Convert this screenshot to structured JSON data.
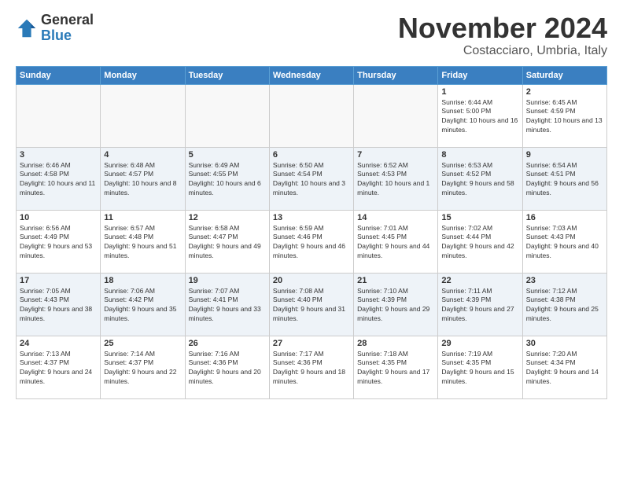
{
  "logo": {
    "general": "General",
    "blue": "Blue"
  },
  "title": "November 2024",
  "subtitle": "Costacciaro, Umbria, Italy",
  "days_of_week": [
    "Sunday",
    "Monday",
    "Tuesday",
    "Wednesday",
    "Thursday",
    "Friday",
    "Saturday"
  ],
  "weeks": [
    [
      {
        "day": "",
        "info": ""
      },
      {
        "day": "",
        "info": ""
      },
      {
        "day": "",
        "info": ""
      },
      {
        "day": "",
        "info": ""
      },
      {
        "day": "",
        "info": ""
      },
      {
        "day": "1",
        "info": "Sunrise: 6:44 AM\nSunset: 5:00 PM\nDaylight: 10 hours and 16 minutes."
      },
      {
        "day": "2",
        "info": "Sunrise: 6:45 AM\nSunset: 4:59 PM\nDaylight: 10 hours and 13 minutes."
      }
    ],
    [
      {
        "day": "3",
        "info": "Sunrise: 6:46 AM\nSunset: 4:58 PM\nDaylight: 10 hours and 11 minutes."
      },
      {
        "day": "4",
        "info": "Sunrise: 6:48 AM\nSunset: 4:57 PM\nDaylight: 10 hours and 8 minutes."
      },
      {
        "day": "5",
        "info": "Sunrise: 6:49 AM\nSunset: 4:55 PM\nDaylight: 10 hours and 6 minutes."
      },
      {
        "day": "6",
        "info": "Sunrise: 6:50 AM\nSunset: 4:54 PM\nDaylight: 10 hours and 3 minutes."
      },
      {
        "day": "7",
        "info": "Sunrise: 6:52 AM\nSunset: 4:53 PM\nDaylight: 10 hours and 1 minute."
      },
      {
        "day": "8",
        "info": "Sunrise: 6:53 AM\nSunset: 4:52 PM\nDaylight: 9 hours and 58 minutes."
      },
      {
        "day": "9",
        "info": "Sunrise: 6:54 AM\nSunset: 4:51 PM\nDaylight: 9 hours and 56 minutes."
      }
    ],
    [
      {
        "day": "10",
        "info": "Sunrise: 6:56 AM\nSunset: 4:49 PM\nDaylight: 9 hours and 53 minutes."
      },
      {
        "day": "11",
        "info": "Sunrise: 6:57 AM\nSunset: 4:48 PM\nDaylight: 9 hours and 51 minutes."
      },
      {
        "day": "12",
        "info": "Sunrise: 6:58 AM\nSunset: 4:47 PM\nDaylight: 9 hours and 49 minutes."
      },
      {
        "day": "13",
        "info": "Sunrise: 6:59 AM\nSunset: 4:46 PM\nDaylight: 9 hours and 46 minutes."
      },
      {
        "day": "14",
        "info": "Sunrise: 7:01 AM\nSunset: 4:45 PM\nDaylight: 9 hours and 44 minutes."
      },
      {
        "day": "15",
        "info": "Sunrise: 7:02 AM\nSunset: 4:44 PM\nDaylight: 9 hours and 42 minutes."
      },
      {
        "day": "16",
        "info": "Sunrise: 7:03 AM\nSunset: 4:43 PM\nDaylight: 9 hours and 40 minutes."
      }
    ],
    [
      {
        "day": "17",
        "info": "Sunrise: 7:05 AM\nSunset: 4:43 PM\nDaylight: 9 hours and 38 minutes."
      },
      {
        "day": "18",
        "info": "Sunrise: 7:06 AM\nSunset: 4:42 PM\nDaylight: 9 hours and 35 minutes."
      },
      {
        "day": "19",
        "info": "Sunrise: 7:07 AM\nSunset: 4:41 PM\nDaylight: 9 hours and 33 minutes."
      },
      {
        "day": "20",
        "info": "Sunrise: 7:08 AM\nSunset: 4:40 PM\nDaylight: 9 hours and 31 minutes."
      },
      {
        "day": "21",
        "info": "Sunrise: 7:10 AM\nSunset: 4:39 PM\nDaylight: 9 hours and 29 minutes."
      },
      {
        "day": "22",
        "info": "Sunrise: 7:11 AM\nSunset: 4:39 PM\nDaylight: 9 hours and 27 minutes."
      },
      {
        "day": "23",
        "info": "Sunrise: 7:12 AM\nSunset: 4:38 PM\nDaylight: 9 hours and 25 minutes."
      }
    ],
    [
      {
        "day": "24",
        "info": "Sunrise: 7:13 AM\nSunset: 4:37 PM\nDaylight: 9 hours and 24 minutes."
      },
      {
        "day": "25",
        "info": "Sunrise: 7:14 AM\nSunset: 4:37 PM\nDaylight: 9 hours and 22 minutes."
      },
      {
        "day": "26",
        "info": "Sunrise: 7:16 AM\nSunset: 4:36 PM\nDaylight: 9 hours and 20 minutes."
      },
      {
        "day": "27",
        "info": "Sunrise: 7:17 AM\nSunset: 4:36 PM\nDaylight: 9 hours and 18 minutes."
      },
      {
        "day": "28",
        "info": "Sunrise: 7:18 AM\nSunset: 4:35 PM\nDaylight: 9 hours and 17 minutes."
      },
      {
        "day": "29",
        "info": "Sunrise: 7:19 AM\nSunset: 4:35 PM\nDaylight: 9 hours and 15 minutes."
      },
      {
        "day": "30",
        "info": "Sunrise: 7:20 AM\nSunset: 4:34 PM\nDaylight: 9 hours and 14 minutes."
      }
    ]
  ]
}
